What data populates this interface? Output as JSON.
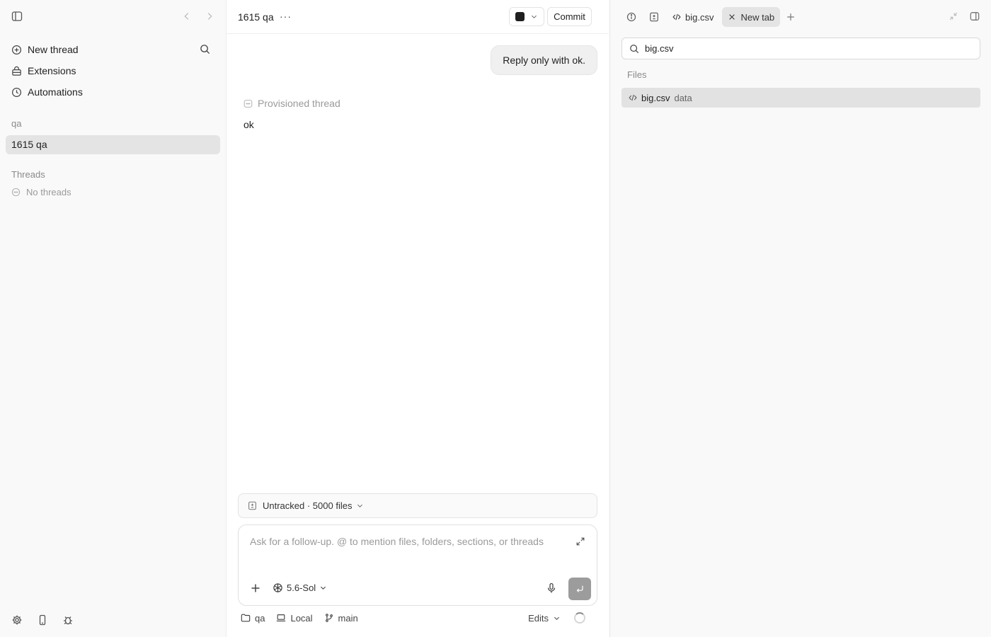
{
  "sidebar": {
    "nav": {
      "new_thread": "New thread",
      "extensions": "Extensions",
      "automations": "Automations"
    },
    "project_section": "qa",
    "active_project": "1615 qa",
    "threads_section": "Threads",
    "no_threads": "No threads"
  },
  "main": {
    "title": "1615 qa",
    "more": "···",
    "commit_label": "Commit",
    "user_message": "Reply only with ok.",
    "provisioned_label": "Provisioned thread",
    "assistant_reply": "ok",
    "untracked_label": "Untracked · 5000 files",
    "composer": {
      "placeholder": "Ask for a follow-up. @ to mention files, folders, sections, or threads",
      "model": "5.6-Sol"
    },
    "footer": {
      "folder": "qa",
      "environment": "Local",
      "branch": "main",
      "edits": "Edits"
    }
  },
  "panel": {
    "tabs": [
      {
        "label": "big.csv",
        "icon": "code-icon"
      },
      {
        "label": "New tab",
        "icon": "close-icon",
        "active": true
      }
    ],
    "search_value": "big.csv",
    "files_label": "Files",
    "result": {
      "name": "big.csv",
      "path": "data"
    }
  }
}
